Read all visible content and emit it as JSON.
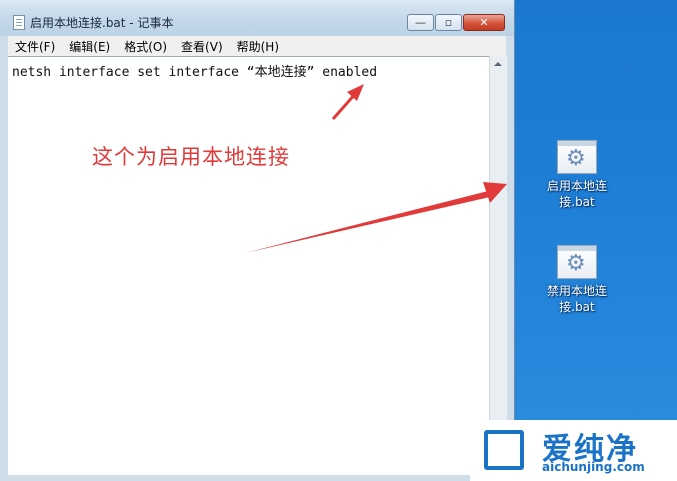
{
  "window": {
    "title": "启用本地连接.bat - 记事本",
    "buttons": {
      "minimize": "—",
      "maximize": "▫",
      "close": "✕"
    }
  },
  "menu": [
    {
      "label": "文件(F)"
    },
    {
      "label": "编辑(E)"
    },
    {
      "label": "格式(O)"
    },
    {
      "label": "查看(V)"
    },
    {
      "label": "帮助(H)"
    }
  ],
  "editor": {
    "content": "netsh interface set interface “本地连接” enabled"
  },
  "annotation": {
    "text": "这个为启用本地连接",
    "color": "#e03a3a"
  },
  "desktop": {
    "icons": [
      {
        "label_line1": "启用本地连",
        "label_line2": "接.bat",
        "icon": "batch-file-icon"
      },
      {
        "label_line1": "禁用本地连",
        "label_line2": "接.bat",
        "icon": "batch-file-icon"
      }
    ]
  },
  "watermark": {
    "brand": "爱纯净",
    "url": "aichunjing.com"
  },
  "colors": {
    "desktop": "#1e7fd6",
    "accent": "#1b73c8",
    "arrow": "#e03a3a"
  }
}
